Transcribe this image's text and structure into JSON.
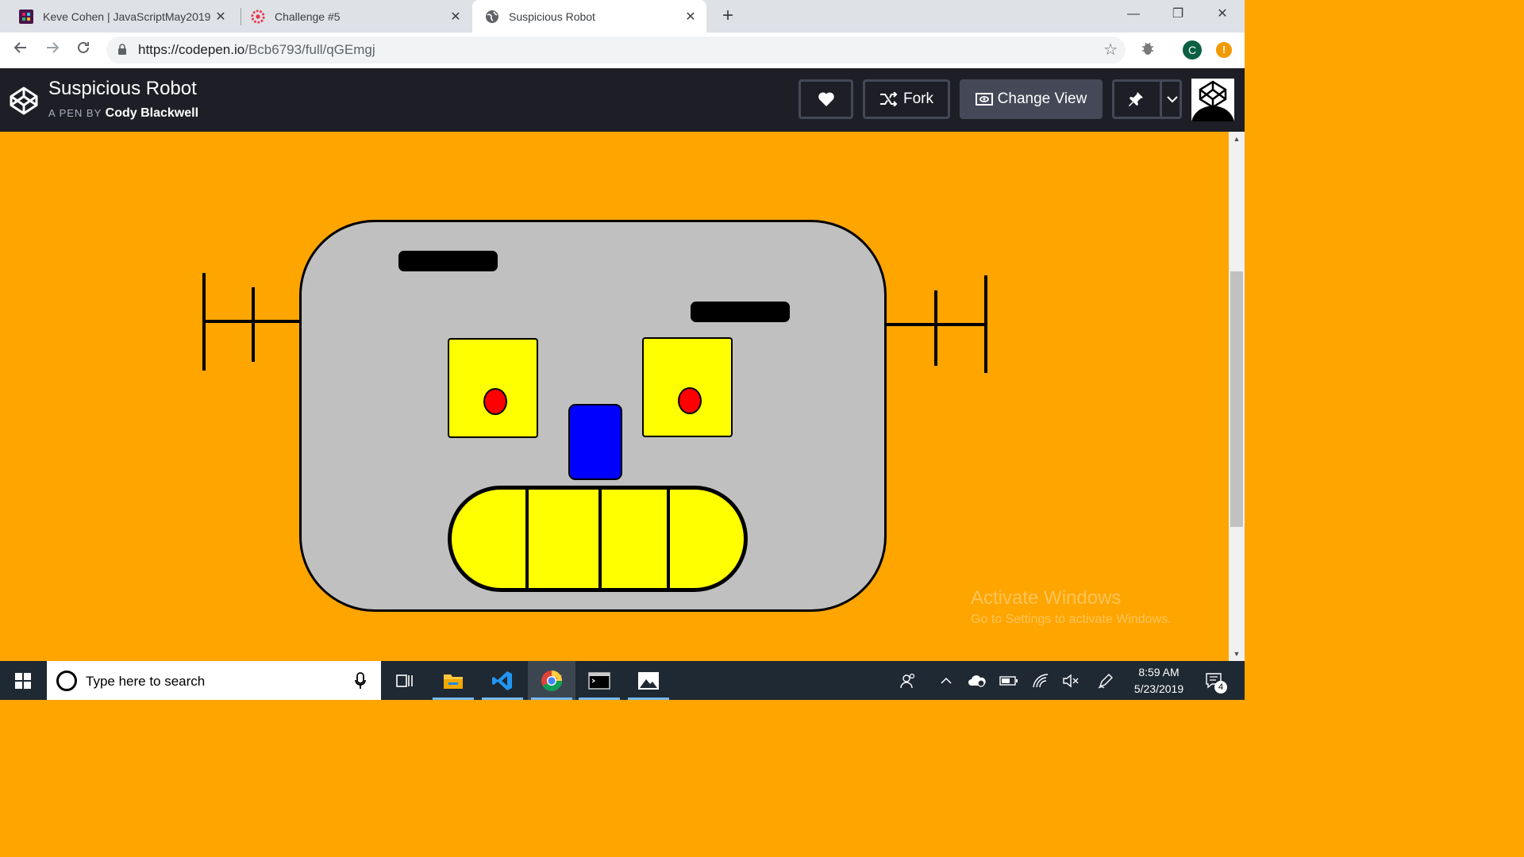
{
  "browser": {
    "tabs": [
      {
        "title": "Keve Cohen | JavaScriptMay2019",
        "icon": "slack-icon"
      },
      {
        "title": "Challenge #5",
        "icon": "challenge-icon"
      },
      {
        "title": "Suspicious Robot",
        "icon": "globe-icon",
        "active": true
      }
    ],
    "url_host": "https://codepen.io",
    "url_path": "/Bcb6793/full/qGEmgj",
    "profile_initial": "C",
    "alert_badge": "!"
  },
  "codepen": {
    "title": "Suspicious Robot",
    "pen_by_label": "A PEN BY",
    "author": "Cody Blackwell",
    "fork_label": "Fork",
    "change_view_label": "Change View"
  },
  "pen": {
    "colors": {
      "background": "#fea500",
      "head": "#c0c0c0",
      "eyes": "#ffff00",
      "pupils": "#ff0000",
      "nose": "#0000ff",
      "mouth": "#ffff00",
      "outline": "#000000"
    }
  },
  "watermark": {
    "line1": "Activate Windows",
    "line2": "Go to Settings to activate Windows."
  },
  "taskbar": {
    "search_placeholder": "Type here to search",
    "time": "8:59 AM",
    "date": "5/23/2019",
    "notification_count": "4"
  }
}
